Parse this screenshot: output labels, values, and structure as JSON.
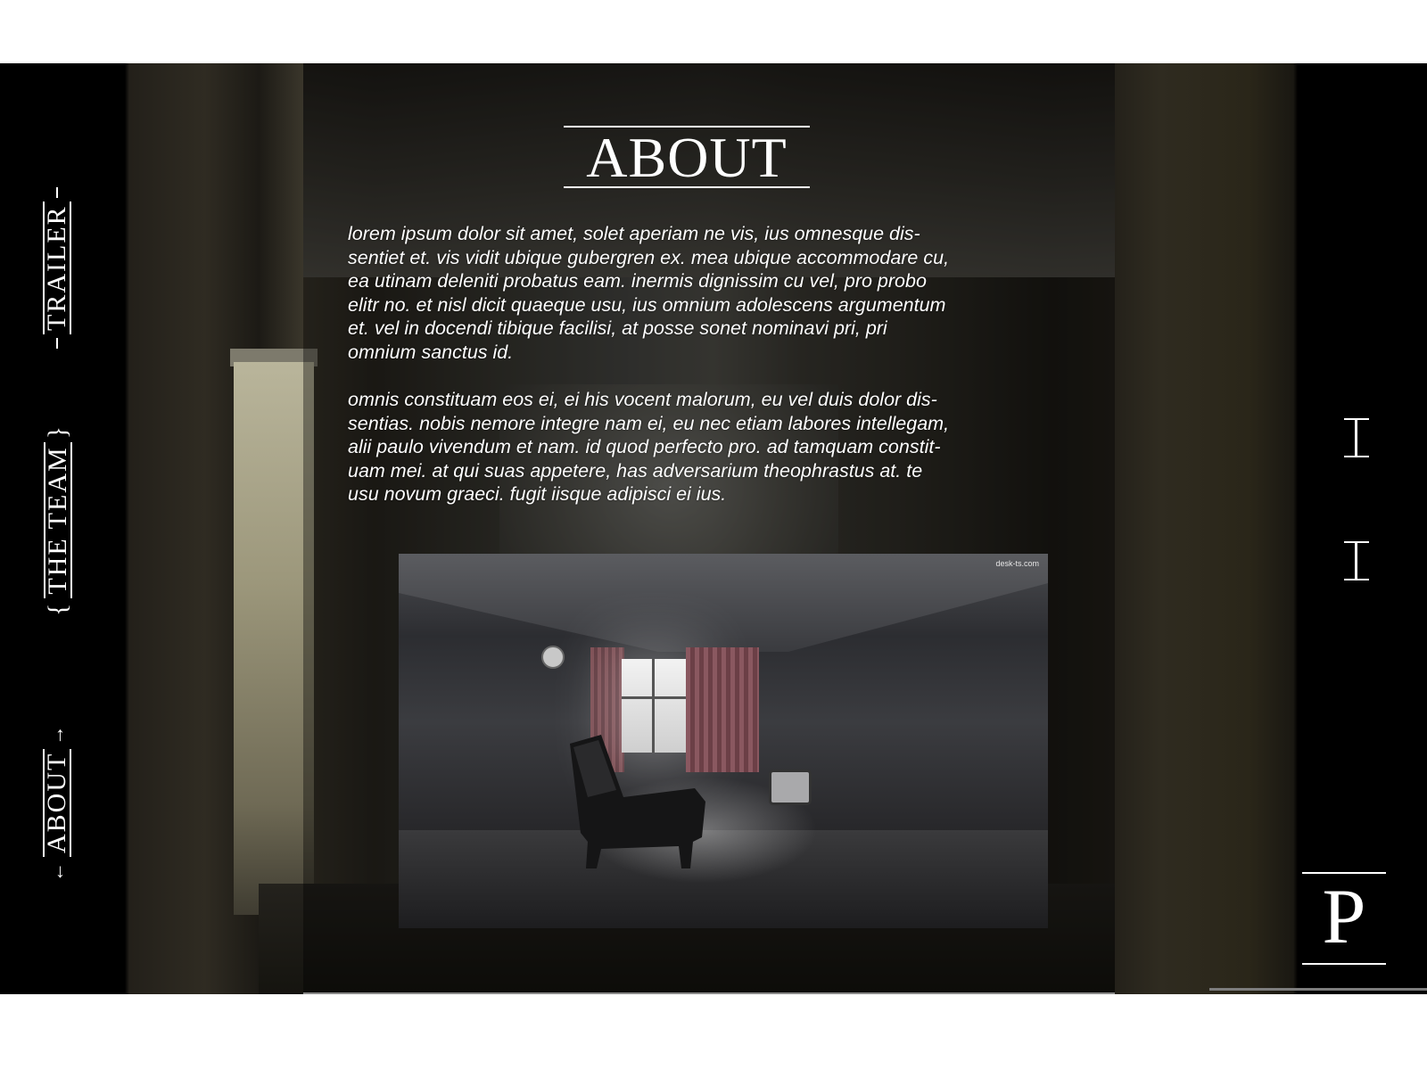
{
  "page": {
    "title": "ABOUT",
    "paragraphs": [
      "lorem ipsum dolor sit amet, solet aperiam ne vis, ius omnesque dis-\nsentiet et. vis vidit ubique gubergren ex. mea ubique accommodare cu,\nea utinam deleniti probatus eam. inermis dignissim cu vel, pro probo\nelitr no. et nisl dicit quaeque usu, ius omnium adolescens argumentum\net. vel in docendi tibique facilisi, at posse sonet nominavi pri, pri\nomnium sanctus id.",
      "omnis constituam eos ei, ei his vocent malorum, eu vel duis dolor dis-\nsentias. nobis nemore integre nam ei, eu nec etiam labores intellegam,\nalii paulo vivendum et nam. id quod perfecto pro. ad tamquam constit-\nuam mei. at qui suas appetere, has adversarium theophrastus at. te\nusu novum graeci. fugit iisque adipisci ei ius."
    ],
    "image_watermark": "desk-ts.com"
  },
  "nav": {
    "items": [
      {
        "label": "TRAILER",
        "left": "—",
        "right": "—"
      },
      {
        "label": "THE TEAM",
        "left": "{",
        "right": "}"
      },
      {
        "label": "ABOUT",
        "left": "←",
        "right": "→"
      }
    ]
  },
  "brand": {
    "logo_letter": "P"
  },
  "colors": {
    "page_bg": "#ffffff",
    "frame_bg": "#000000",
    "text": "#ffffff"
  }
}
